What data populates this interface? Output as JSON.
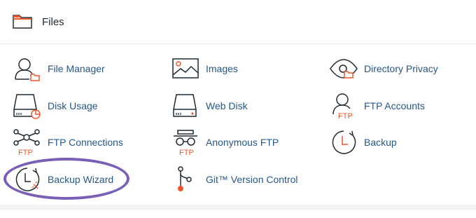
{
  "section": {
    "title": "Files",
    "icon": "folder-icon"
  },
  "items": [
    {
      "label": "File Manager",
      "icon": "file-manager-icon"
    },
    {
      "label": "Images",
      "icon": "image-icon"
    },
    {
      "label": "Directory Privacy",
      "icon": "eye-folder-icon"
    },
    {
      "label": "Disk Usage",
      "icon": "disk-usage-icon"
    },
    {
      "label": "Web Disk",
      "icon": "web-disk-icon"
    },
    {
      "label": "FTP Accounts",
      "icon": "ftp-user-icon"
    },
    {
      "label": "FTP Connections",
      "icon": "ftp-connections-icon"
    },
    {
      "label": "Anonymous FTP",
      "icon": "anonymous-ftp-icon"
    },
    {
      "label": "Backup",
      "icon": "backup-clock-icon"
    },
    {
      "label": "Backup Wizard",
      "icon": "backup-wizard-icon"
    },
    {
      "label": "Git™ Version Control",
      "icon": "git-icon"
    }
  ],
  "icon_text": {
    "ftp": "FTP"
  },
  "colors": {
    "label": "#25578a",
    "icon_dark": "#1f2a33",
    "accent_orange": "#f0542b",
    "highlight": "#7a5fb6"
  }
}
